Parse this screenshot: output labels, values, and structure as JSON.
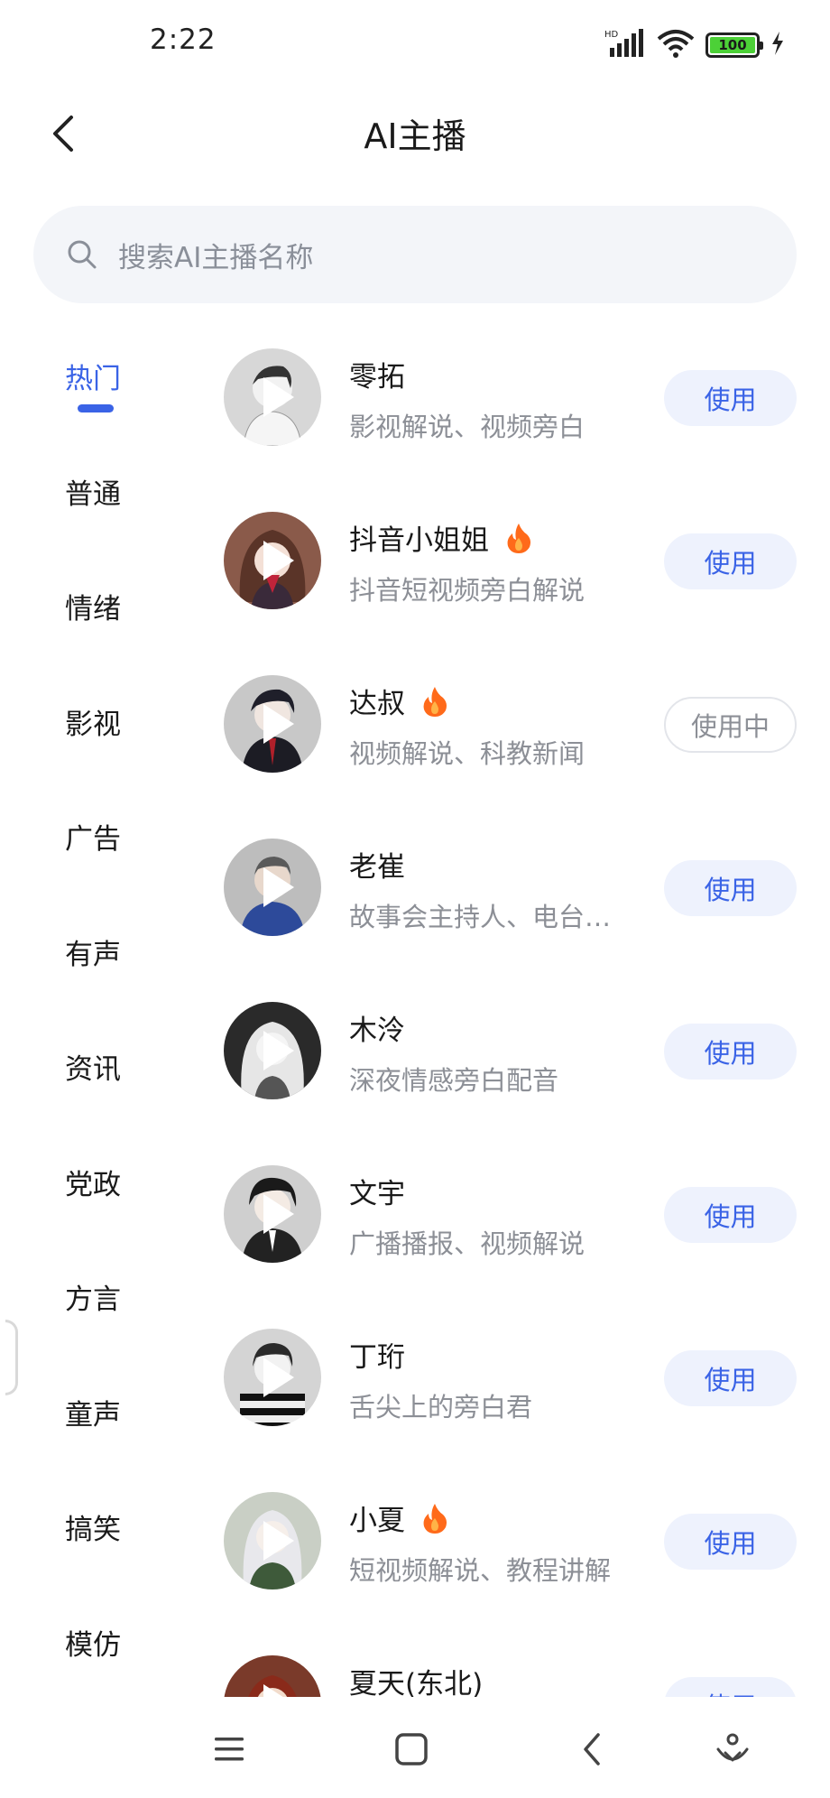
{
  "status_bar": {
    "time": "2:22",
    "battery": "100",
    "network": "HD"
  },
  "header": {
    "title": "AI主播"
  },
  "search": {
    "placeholder": "搜索AI主播名称"
  },
  "categories": [
    {
      "label": "热门",
      "active": true
    },
    {
      "label": "普通"
    },
    {
      "label": "情绪"
    },
    {
      "label": "影视"
    },
    {
      "label": "广告"
    },
    {
      "label": "有声"
    },
    {
      "label": "资讯"
    },
    {
      "label": "党政"
    },
    {
      "label": "方言"
    },
    {
      "label": "童声"
    },
    {
      "label": "搞笑"
    },
    {
      "label": "模仿"
    }
  ],
  "voices": [
    {
      "name": "零拓",
      "desc": "影视解说、视频旁白",
      "hot": false,
      "button": "使用",
      "in_use": false
    },
    {
      "name": "抖音小姐姐",
      "desc": "抖音短视频旁白解说",
      "hot": true,
      "button": "使用",
      "in_use": false
    },
    {
      "name": "达叔",
      "desc": "视频解说、科教新闻",
      "hot": true,
      "button": "使用中",
      "in_use": true
    },
    {
      "name": "老崔",
      "desc": "故事会主持人、电台…",
      "hot": false,
      "button": "使用",
      "in_use": false
    },
    {
      "name": "木泠",
      "desc": "深夜情感旁白配音",
      "hot": false,
      "button": "使用",
      "in_use": false
    },
    {
      "name": "文宇",
      "desc": "广播播报、视频解说",
      "hot": false,
      "button": "使用",
      "in_use": false
    },
    {
      "name": "丁珩",
      "desc": "舌尖上的旁白君",
      "hot": false,
      "button": "使用",
      "in_use": false
    },
    {
      "name": "小夏",
      "desc": "短视频解说、教程讲解",
      "hot": true,
      "button": "使用",
      "in_use": false
    },
    {
      "name": "夏天(东北)",
      "desc": "",
      "hot": false,
      "button": "使用",
      "in_use": false
    }
  ],
  "colors": {
    "accent": "#3a63e6",
    "hot": "#ff6a1a",
    "muted": "#8c8f96"
  }
}
